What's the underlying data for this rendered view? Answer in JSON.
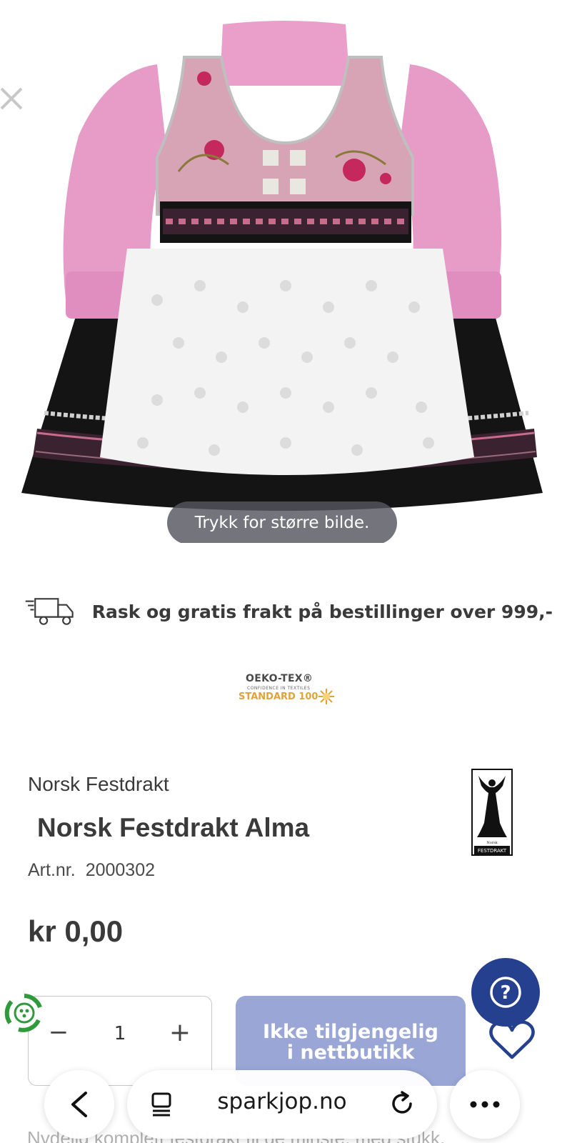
{
  "image": {
    "alt": "",
    "zoom_hint": "Trykk for større bilde."
  },
  "shipping": {
    "icon": "delivery-truck-icon",
    "text": "Rask og gratis frakt på bestillinger over 999,-"
  },
  "certification": {
    "line1": "OEKO-TEX®",
    "line2": "CONFIDENCE IN TEXTILES",
    "line3": "STANDARD 100"
  },
  "product": {
    "brand": "Norsk Festdrakt",
    "title": "Norsk Festdrakt Alma",
    "art_label": "Art.nr.",
    "art_number": "2000302",
    "price": "kr 0,00",
    "logo_text_top": "Norsk",
    "logo_text_bottom": "FESTDRAKT"
  },
  "cart": {
    "minus_label": "−",
    "quantity": "1",
    "plus_label": "+",
    "button_line1": "Ikke tilgjengelig",
    "button_line2": "i nettbutikk"
  },
  "help": {
    "label": "?"
  },
  "description": {
    "preview": "Nydelig komplett festdrakt til de minste, med stukk."
  },
  "browser": {
    "url": "sparkjop.no"
  },
  "colors": {
    "accent_button": "#9aa6d6",
    "help_button": "#24408e",
    "text": "#3a3a3a"
  }
}
